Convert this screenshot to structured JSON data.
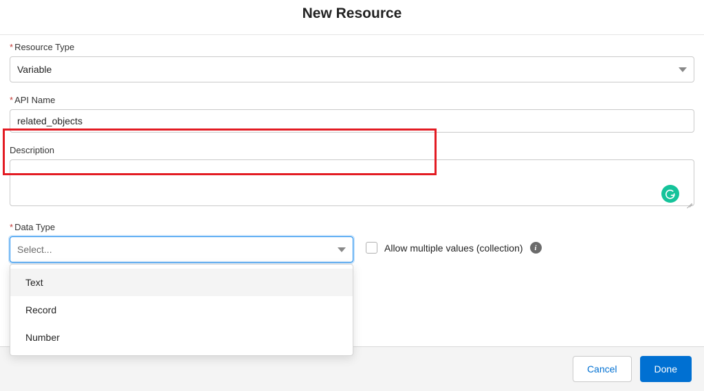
{
  "header": {
    "title": "New Resource"
  },
  "resourceType": {
    "label": "Resource Type",
    "value": "Variable"
  },
  "apiName": {
    "label": "API Name",
    "value": "related_objects"
  },
  "description": {
    "label": "Description",
    "value": ""
  },
  "dataType": {
    "label": "Data Type",
    "placeholder": "Select...",
    "options": [
      "Text",
      "Record",
      "Number"
    ]
  },
  "allowMultiple": {
    "label": "Allow multiple values (collection)"
  },
  "footer": {
    "cancel": "Cancel",
    "done": "Done"
  }
}
